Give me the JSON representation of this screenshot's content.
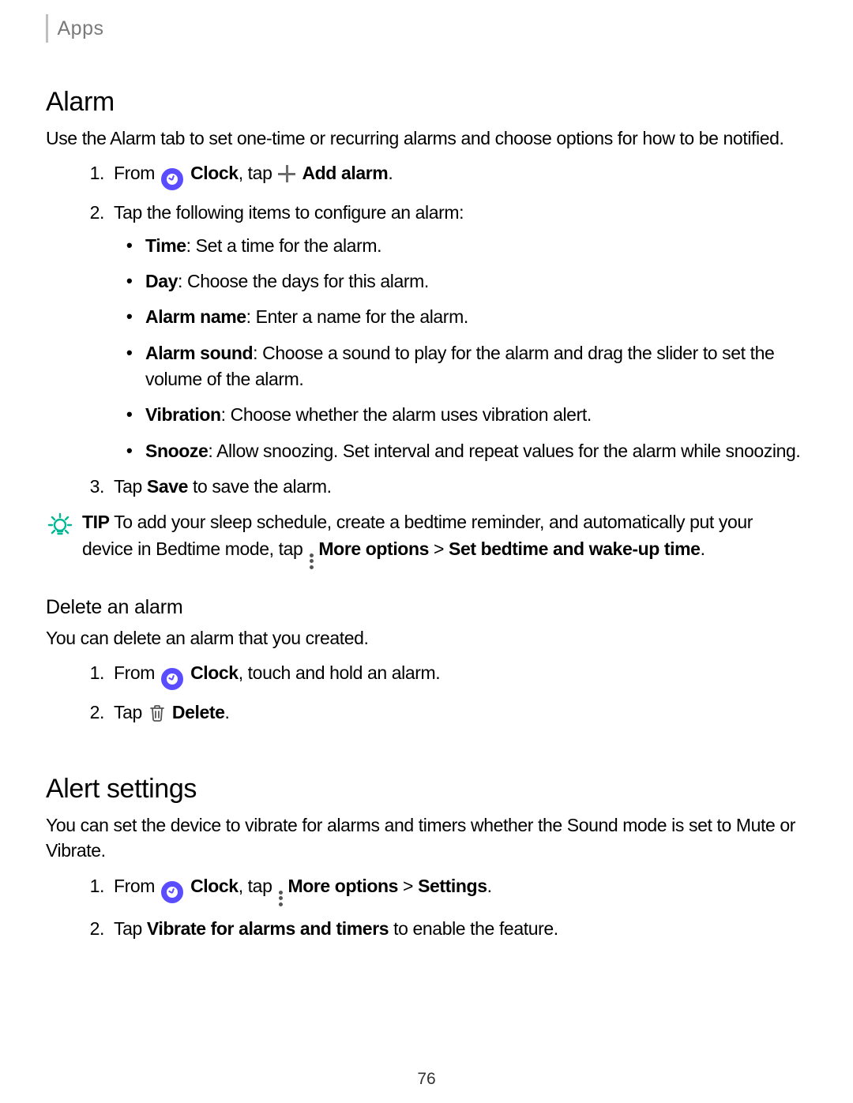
{
  "breadcrumb": "Apps",
  "page_number": "76",
  "alarm": {
    "heading": "Alarm",
    "intro": "Use the Alarm tab to set one-time or recurring alarms and choose options for how to be notified.",
    "step1": {
      "pre": "From ",
      "clock_label": "Clock",
      "mid": ", tap ",
      "add_label": "Add alarm",
      "end": "."
    },
    "step2_intro": "Tap the following items to configure an alarm:",
    "items": [
      {
        "label": "Time",
        "sep": ": ",
        "desc": "Set a time for the alarm."
      },
      {
        "label": "Day",
        "sep": ": ",
        "desc": "Choose the days for this alarm."
      },
      {
        "label": "Alarm name",
        "sep": ": ",
        "desc": "Enter a name for the alarm."
      },
      {
        "label": "Alarm sound",
        "sep": ": ",
        "desc": "Choose a sound to play for the alarm and drag the slider to set the volume of the alarm."
      },
      {
        "label": "Vibration",
        "sep": ": ",
        "desc": "Choose whether the alarm uses vibration alert."
      },
      {
        "label": "Snooze",
        "sep": ": ",
        "desc": "Allow snoozing. Set interval and repeat values for the alarm while snoozing."
      }
    ],
    "step3": {
      "pre": "Tap ",
      "label": "Save",
      "post": " to save the alarm."
    },
    "tip": {
      "prefix": "TIP",
      "text1": "  To add your sleep schedule, create a bedtime reminder, and automatically put your device in Bedtime mode, tap ",
      "more_label": "More options",
      "sep": " > ",
      "set_label": "Set bedtime and wake-up time",
      "end": "."
    }
  },
  "delete": {
    "heading": "Delete an alarm",
    "intro": "You can delete an alarm that you created.",
    "step1": {
      "pre": "From ",
      "clock_label": "Clock",
      "post": ", touch and hold an alarm."
    },
    "step2": {
      "pre": "Tap ",
      "label": "Delete",
      "end": "."
    }
  },
  "alert": {
    "heading": "Alert settings",
    "intro": "You can set the device to vibrate for alarms and timers whether the Sound mode is set to Mute or Vibrate.",
    "step1": {
      "pre": "From ",
      "clock_label": "Clock",
      "mid": ", tap ",
      "more_label": "More options",
      "sep": " > ",
      "settings_label": "Settings",
      "end": "."
    },
    "step2": {
      "pre": "Tap ",
      "label": "Vibrate for alarms and timers",
      "post": " to enable the feature."
    }
  }
}
